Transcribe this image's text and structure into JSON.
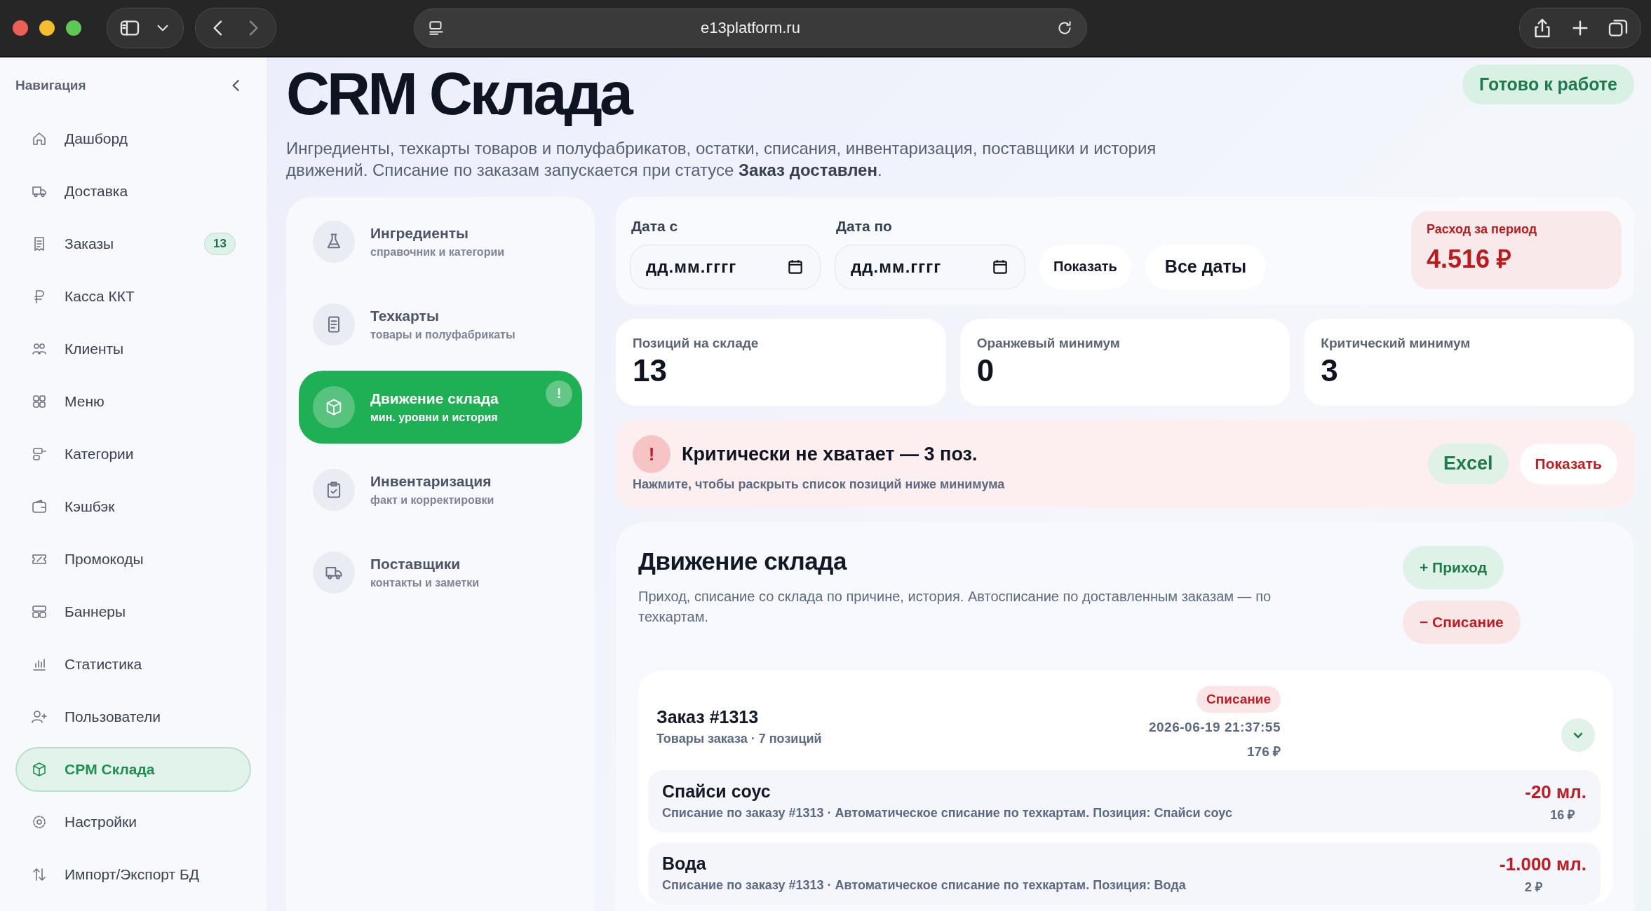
{
  "browser": {
    "url": "e13platform.ru"
  },
  "sidebar": {
    "title": "Навигация",
    "items": [
      {
        "label": "Дашборд",
        "selected": false
      },
      {
        "label": "Доставка",
        "selected": false
      },
      {
        "label": "Заказы",
        "selected": false,
        "badge": "13"
      },
      {
        "label": "Касса ККТ",
        "selected": false
      },
      {
        "label": "Клиенты",
        "selected": false
      },
      {
        "label": "Меню",
        "selected": false
      },
      {
        "label": "Категории",
        "selected": false
      },
      {
        "label": "Кэшбэк",
        "selected": false
      },
      {
        "label": "Промокоды",
        "selected": false
      },
      {
        "label": "Баннеры",
        "selected": false
      },
      {
        "label": "Статистика",
        "selected": false
      },
      {
        "label": "Пользователи",
        "selected": false
      },
      {
        "label": "CPM Склада",
        "selected": true
      },
      {
        "label": "Настройки",
        "selected": false
      },
      {
        "label": "Импорт/Экспорт БД",
        "selected": false
      }
    ]
  },
  "header": {
    "title": "CRM Склада",
    "description": "Ингредиенты, техкарты товаров и полуфабрикатов, остатки, списания, инвентаризация, поставщики и история движений. Списание по заказам запускается при статусе **Заказ доставлен**.",
    "status": "Готово к работе"
  },
  "sections": [
    {
      "title": "Ингредиенты",
      "subtitle": "справочник и категории",
      "selected": false
    },
    {
      "title": "Техкарты",
      "subtitle": "товары и полуфабрикаты",
      "selected": false
    },
    {
      "title": "Движение склада",
      "subtitle": "мин. уровни и история",
      "selected": true,
      "badge": "!"
    },
    {
      "title": "Инвентаризация",
      "subtitle": "факт и корректировки",
      "selected": false
    },
    {
      "title": "Поставщики",
      "subtitle": "контакты и заметки",
      "selected": false
    }
  ],
  "filter": {
    "date_from": {
      "label": "Дата с",
      "placeholder": "дд.мм.гггг"
    },
    "date_to": {
      "label": "Дата по",
      "placeholder": "дд.мм.гггг"
    },
    "show_button": "Показать",
    "all_dates_button": "Все даты",
    "expense": {
      "label": "Расход за период",
      "value": "4.516 ₽"
    }
  },
  "stats": [
    {
      "label": "Позиций на складе",
      "value": "13"
    },
    {
      "label": "Оранжевый минимум",
      "value": "0"
    },
    {
      "label": "Критический минимум",
      "value": "3"
    }
  ],
  "alert": {
    "icon": "!",
    "title": "Критически не хватает — 3 поз.",
    "subtitle": "Нажмите, чтобы раскрыть список позиций ниже минимума",
    "excel_button": "Excel",
    "show_button": "Показать"
  },
  "movement": {
    "title": "Движение склада",
    "description": "Приход, списание со склада по причине, история. Автосписание по доставленным заказам — по техкартам.",
    "income_button": "+ Приход",
    "writeoff_button": "− Списание",
    "group": {
      "title": "Заказ #1313",
      "subtitle": "Товары заказа · 7 позиций",
      "tag": "Списание",
      "datetime": "2026-06-19 21:37:55",
      "total": "176 ₽",
      "expanded": true,
      "rows": [
        {
          "name": "Спайси соус",
          "note": "Списание по заказу #1313 · Автоматическое списание по техкартам. Позиция: Спайси соус",
          "quantity": "-20 мл.",
          "amount": "16 ₽"
        },
        {
          "name": "Вода",
          "note": "Списание по заказу #1313 · Автоматическое списание по техкартам. Позиция: Вода",
          "quantity": "-1.000 мл.",
          "amount": "2 ₽"
        }
      ]
    }
  }
}
